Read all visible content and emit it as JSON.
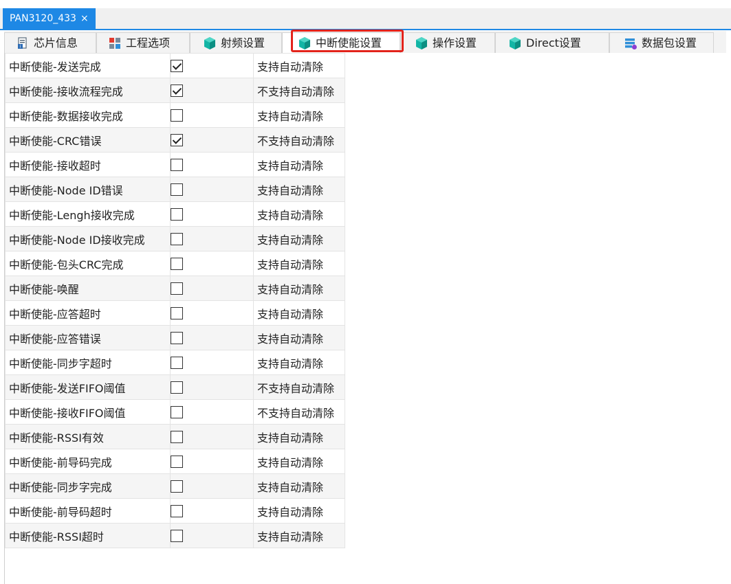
{
  "document_tab": {
    "title": "PAN3120_433",
    "close_glyph": "×"
  },
  "tabs": [
    {
      "label": "芯片信息",
      "icon": "chip-info-icon"
    },
    {
      "label": "工程选项",
      "icon": "project-options-icon"
    },
    {
      "label": "射频设置",
      "icon": "cube-icon"
    },
    {
      "label": "中断使能设置",
      "icon": "cube-icon",
      "active": true
    },
    {
      "label": "操作设置",
      "icon": "cube-icon"
    },
    {
      "label": "Direct设置",
      "icon": "cube-icon"
    },
    {
      "label": "数据包设置",
      "icon": "packet-settings-icon"
    }
  ],
  "interrupts": [
    {
      "name": "中断使能-发送完成",
      "checked": true,
      "clear": "支持自动清除"
    },
    {
      "name": "中断使能-接收流程完成",
      "checked": true,
      "clear": "不支持自动清除"
    },
    {
      "name": "中断使能-数据接收完成",
      "checked": false,
      "clear": "支持自动清除"
    },
    {
      "name": "中断使能-CRC错误",
      "checked": true,
      "clear": "不支持自动清除"
    },
    {
      "name": "中断使能-接收超时",
      "checked": false,
      "clear": "支持自动清除"
    },
    {
      "name": "中断使能-Node ID错误",
      "checked": false,
      "clear": "支持自动清除"
    },
    {
      "name": "中断使能-Lengh接收完成",
      "checked": false,
      "clear": "支持自动清除"
    },
    {
      "name": "中断使能-Node ID接收完成",
      "checked": false,
      "clear": "支持自动清除"
    },
    {
      "name": "中断使能-包头CRC完成",
      "checked": false,
      "clear": "支持自动清除"
    },
    {
      "name": "中断使能-唤醒",
      "checked": false,
      "clear": "支持自动清除"
    },
    {
      "name": "中断使能-应答超时",
      "checked": false,
      "clear": "支持自动清除"
    },
    {
      "name": "中断使能-应答错误",
      "checked": false,
      "clear": "支持自动清除"
    },
    {
      "name": "中断使能-同步字超时",
      "checked": false,
      "clear": "支持自动清除"
    },
    {
      "name": "中断使能-发送FIFO阈值",
      "checked": false,
      "clear": "不支持自动清除"
    },
    {
      "name": "中断使能-接收FIFO阈值",
      "checked": false,
      "clear": "不支持自动清除"
    },
    {
      "name": "中断使能-RSSI有效",
      "checked": false,
      "clear": "支持自动清除"
    },
    {
      "name": "中断使能-前导码完成",
      "checked": false,
      "clear": "支持自动清除"
    },
    {
      "name": "中断使能-同步字完成",
      "checked": false,
      "clear": "支持自动清除"
    },
    {
      "name": "中断使能-前导码超时",
      "checked": false,
      "clear": "支持自动清除"
    },
    {
      "name": "中断使能-RSSI超时",
      "checked": false,
      "clear": "支持自动清除"
    }
  ],
  "colors": {
    "accent": "#1e88e5",
    "highlight": "#e3231b",
    "cube_teal": "#13b5a5"
  }
}
